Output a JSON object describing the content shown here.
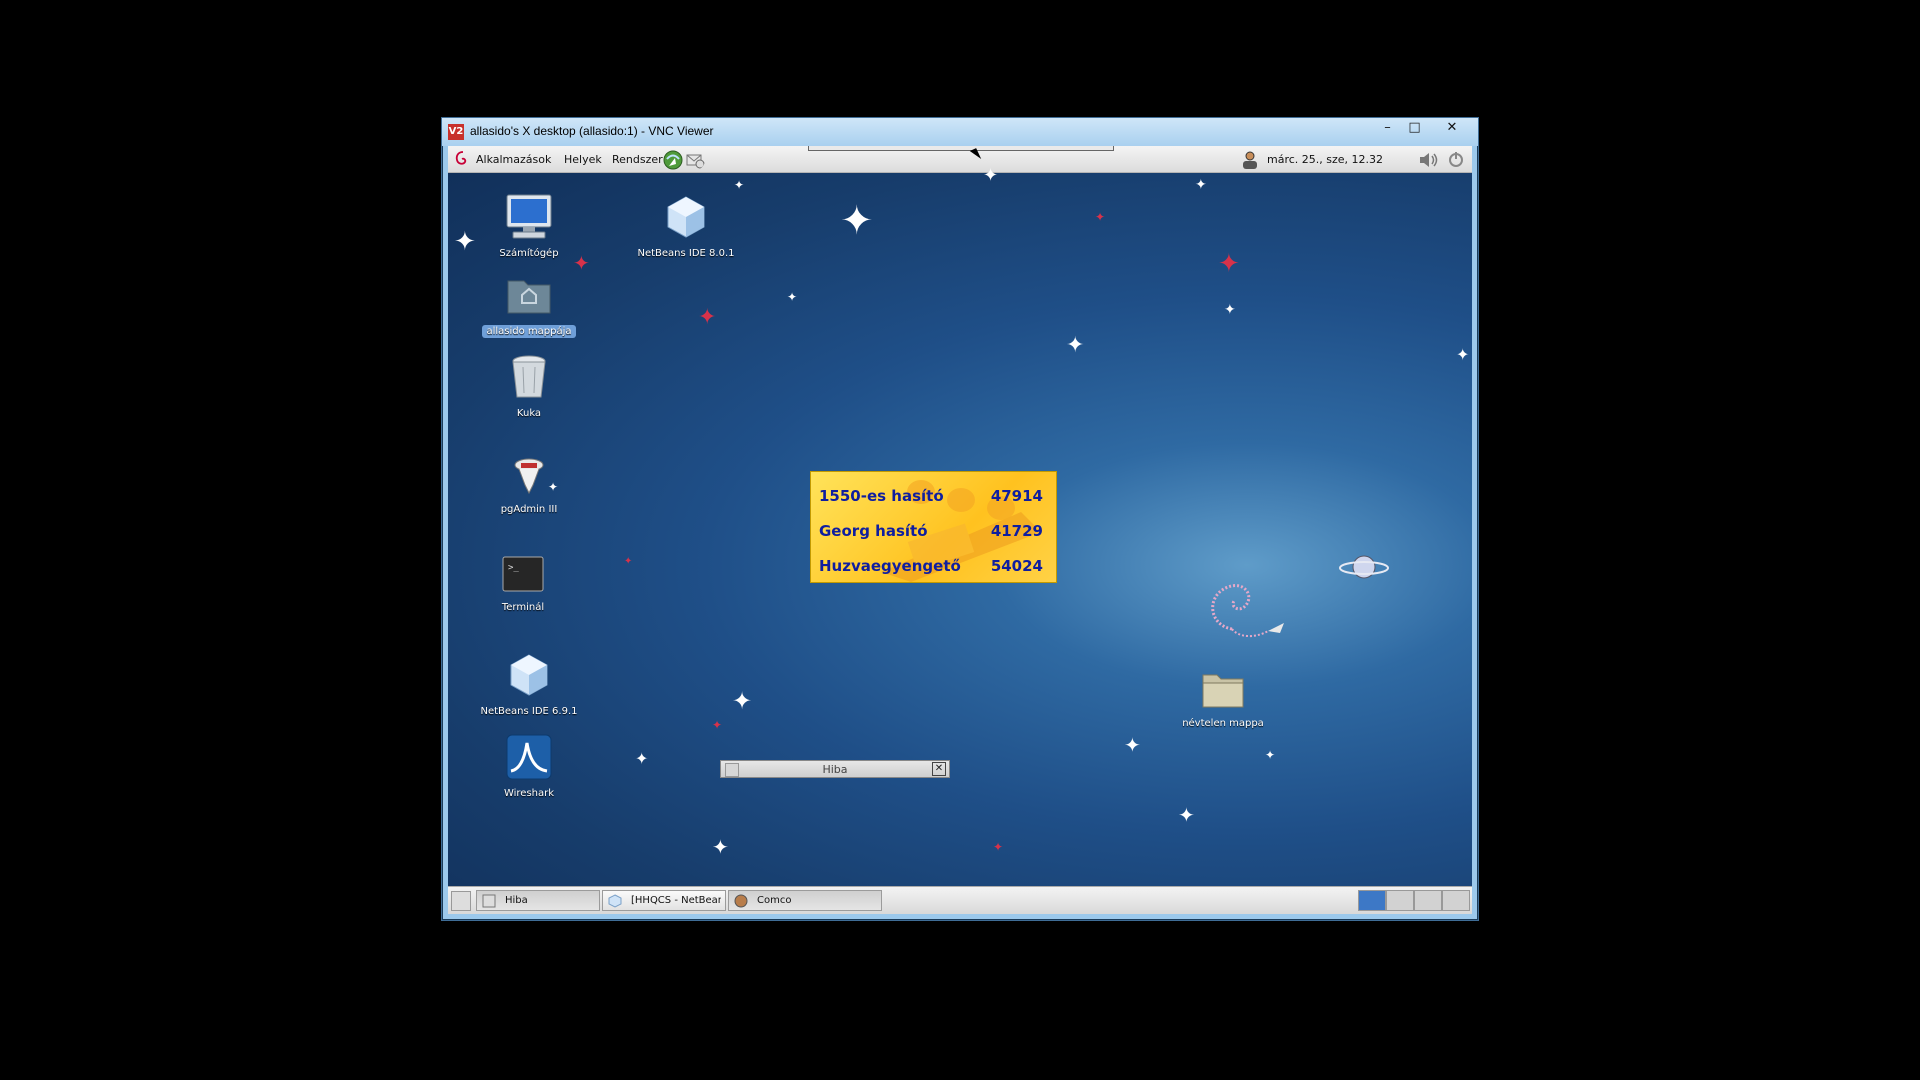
{
  "vnc": {
    "title": "allasido's X desktop (allasido:1) - VNC Viewer",
    "app_icon": "V2",
    "minimize": "–",
    "maximize": "□",
    "close": "✕"
  },
  "top_panel": {
    "menu": [
      "Alkalmazások",
      "Helyek",
      "Rendszer"
    ],
    "clock": "márc. 25., sze, 12.32"
  },
  "desktop_icons": [
    {
      "label": "Számítógép",
      "icon": "computer-icon"
    },
    {
      "label": "NetBeans IDE 8.0.1",
      "icon": "netbeans-icon"
    },
    {
      "label": "allasido mappája",
      "icon": "home-folder-icon"
    },
    {
      "label": "Kuka",
      "icon": "trash-icon"
    },
    {
      "label": "pgAdmin III",
      "icon": "pgadmin-icon"
    },
    {
      "label": "Terminál",
      "icon": "terminal-icon"
    },
    {
      "label": "NetBeans IDE 6.9.1",
      "icon": "netbeans-icon"
    },
    {
      "label": "Wireshark",
      "icon": "wireshark-icon"
    },
    {
      "label": "névtelen mappa",
      "icon": "folder-icon"
    }
  ],
  "ticker": {
    "rows": [
      {
        "name": "1550-es hasító",
        "value": "47914"
      },
      {
        "name": "Georg hasító",
        "value": "41729"
      },
      {
        "name": "Huzvaegyengető",
        "value": "54024"
      }
    ]
  },
  "dialog": {
    "title": "Hiba",
    "close": "✕"
  },
  "taskbar": {
    "tasks": [
      {
        "label": "Hiba"
      },
      {
        "label": "[HHQCS - NetBeans ..."
      },
      {
        "label": "Comco"
      }
    ]
  },
  "colors": {
    "ticker_text": "#0f1ea0",
    "ticker_bg": "#ffd02a",
    "desktop": "#1f4f88"
  }
}
